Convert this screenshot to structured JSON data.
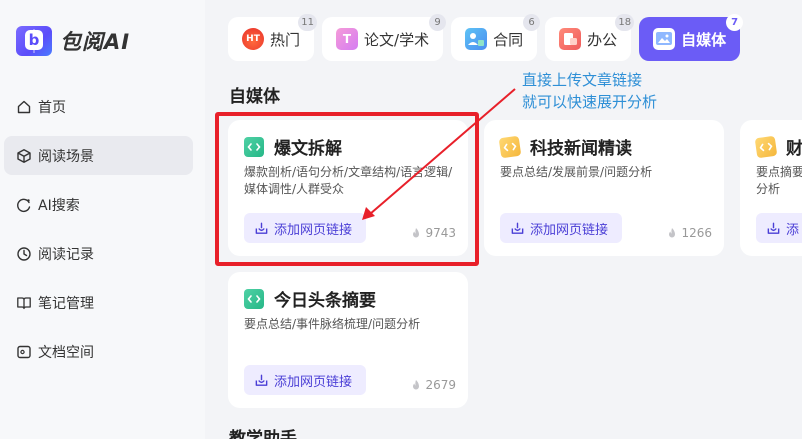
{
  "app": {
    "logo_letter": "b",
    "name": "包阅AI"
  },
  "sidebar": {
    "items": [
      {
        "label": "首页",
        "icon": "home-icon"
      },
      {
        "label": "阅读场景",
        "icon": "cube-icon",
        "active": true
      },
      {
        "label": "AI搜索",
        "icon": "search-ai-icon"
      },
      {
        "label": "阅读记录",
        "icon": "clock-icon"
      },
      {
        "label": "笔记管理",
        "icon": "book-open-icon"
      },
      {
        "label": "文档空间",
        "icon": "folder-icon"
      }
    ]
  },
  "tabs": [
    {
      "label": "热门",
      "count": "11",
      "icon": "hot-icon",
      "icon_text": "HT"
    },
    {
      "label": "论文/学术",
      "count": "9",
      "icon": "paper-icon",
      "icon_text": "T"
    },
    {
      "label": "合同",
      "count": "6",
      "icon": "contract-icon",
      "icon_text": ""
    },
    {
      "label": "办公",
      "count": "18",
      "icon": "office-icon",
      "icon_text": ""
    },
    {
      "label": "自媒体",
      "count": "7",
      "icon": "media-icon",
      "icon_text": "",
      "active": true
    }
  ],
  "section": {
    "title": "自媒体",
    "next_title": "教学助手"
  },
  "cards": [
    {
      "title": "爆文拆解",
      "desc": "爆款剖析/语句分析/文章结构/语言逻辑/媒体调性/人群受众",
      "button": "添加网页链接",
      "count": "9743"
    },
    {
      "title": "科技新闻精读",
      "desc": "要点总结/发展前景/问题分析",
      "button": "添加网页链接",
      "count": "1266"
    },
    {
      "title": "财",
      "desc": "要点摘要分析",
      "button": "添",
      "count": ""
    },
    {
      "title": "今日头条摘要",
      "desc": "要点总结/事件脉络梳理/问题分析",
      "button": "添加网页链接",
      "count": "2679"
    }
  ],
  "annotation": {
    "line1": "直接上传文章链接",
    "line2": "就可以快速展开分析"
  },
  "colors": {
    "accent": "#6b5cf6",
    "highlight": "#e8202a",
    "callout": "#2e8fd6"
  }
}
